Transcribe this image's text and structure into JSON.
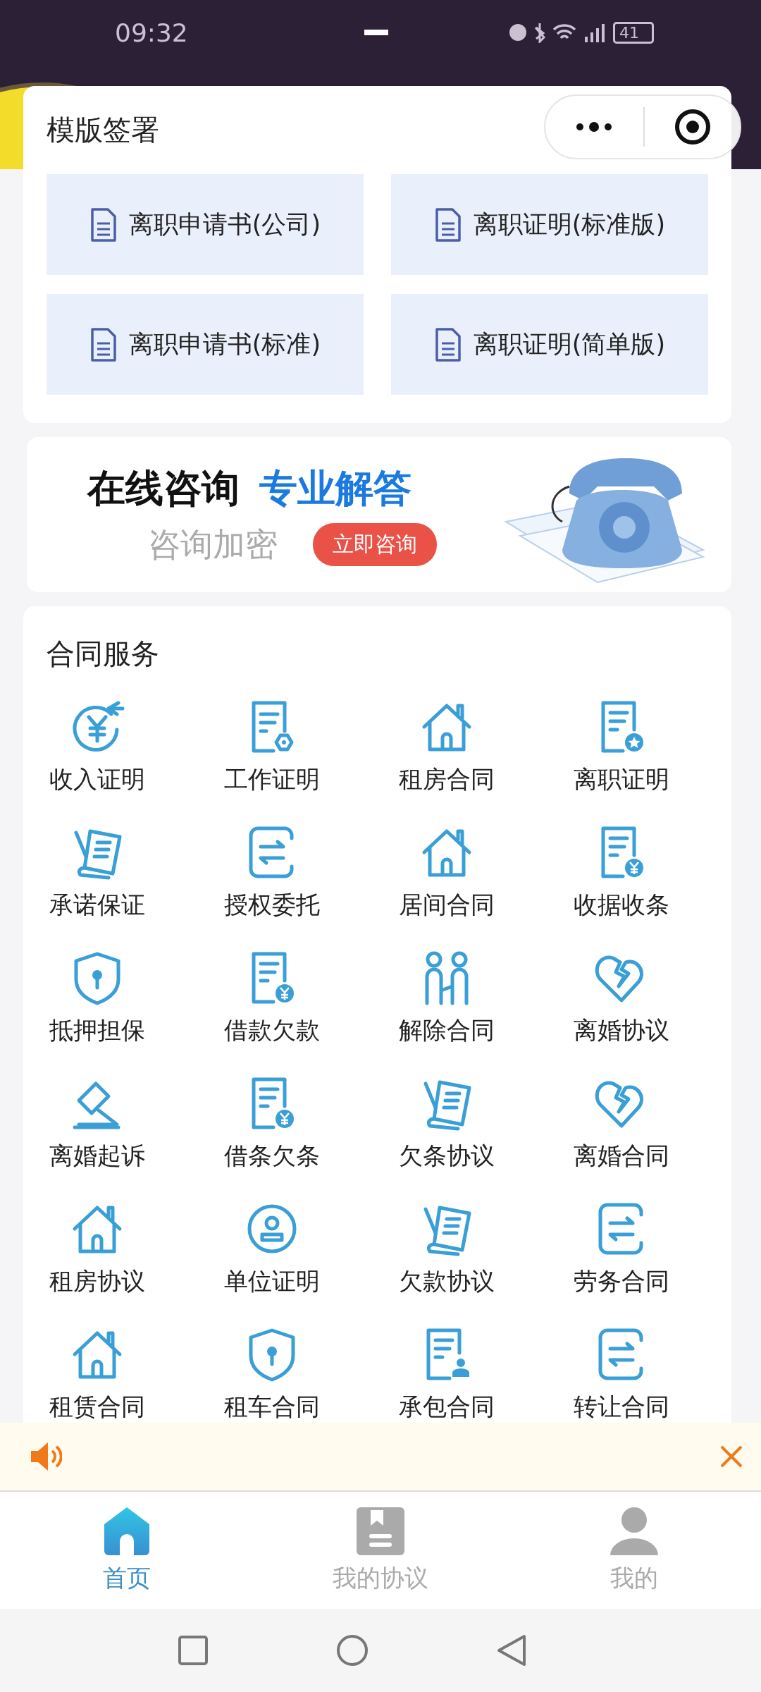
{
  "status_bar": {
    "time": "09:32",
    "battery": "41"
  },
  "templates": {
    "title": "模版签署",
    "items": [
      {
        "label": "离职申请书(公司)"
      },
      {
        "label": "离职证明(标准版)"
      },
      {
        "label": "离职申请书(标准)"
      },
      {
        "label": "离职证明(简单版)"
      }
    ]
  },
  "banner": {
    "headline": "在线咨询",
    "highlight": "专业解答",
    "subtitle": "咨询加密",
    "button": "立即咨询"
  },
  "services": {
    "title": "合同服务",
    "items": [
      {
        "label": "收入证明",
        "kind": "yen-cycle"
      },
      {
        "label": "工作证明",
        "kind": "doc-gear"
      },
      {
        "label": "租房合同",
        "kind": "house"
      },
      {
        "label": "离职证明",
        "kind": "doc-star"
      },
      {
        "label": "承诺保证",
        "kind": "pen-paper"
      },
      {
        "label": "授权委托",
        "kind": "exchange"
      },
      {
        "label": "居间合同",
        "kind": "house"
      },
      {
        "label": "收据收条",
        "kind": "doc-yen"
      },
      {
        "label": "抵押担保",
        "kind": "shield"
      },
      {
        "label": "借款欠款",
        "kind": "doc-yen"
      },
      {
        "label": "解除合同",
        "kind": "people"
      },
      {
        "label": "离婚协议",
        "kind": "broken-heart"
      },
      {
        "label": "离婚起诉",
        "kind": "gavel"
      },
      {
        "label": "借条欠条",
        "kind": "doc-yen"
      },
      {
        "label": "欠条协议",
        "kind": "pen-paper"
      },
      {
        "label": "离婚合同",
        "kind": "broken-heart"
      },
      {
        "label": "租房协议",
        "kind": "house"
      },
      {
        "label": "单位证明",
        "kind": "badge"
      },
      {
        "label": "欠款协议",
        "kind": "pen-paper"
      },
      {
        "label": "劳务合同",
        "kind": "exchange"
      },
      {
        "label": "租赁合同",
        "kind": "house"
      },
      {
        "label": "租车合同",
        "kind": "shield"
      },
      {
        "label": "承包合同",
        "kind": "doc-person"
      },
      {
        "label": "转让合同",
        "kind": "exchange"
      }
    ]
  },
  "tabs": [
    {
      "label": "首页",
      "kind": "home",
      "selected": true
    },
    {
      "label": "我的协议",
      "kind": "book",
      "selected": false
    },
    {
      "label": "我的",
      "kind": "person",
      "selected": false
    }
  ]
}
